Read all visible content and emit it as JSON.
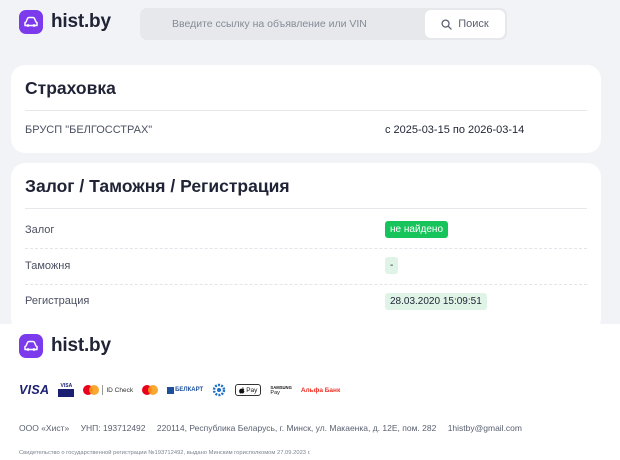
{
  "header": {
    "logo_text": "hist.by",
    "search": {
      "placeholder": "Введите ссылку на объявление или VIN",
      "button_label": "Поиск"
    }
  },
  "insurance": {
    "title": "Страховка",
    "company": "БРУСП \"БЕЛГОССТРАХ\"",
    "period": "с 2025-03-15 по 2026-03-14"
  },
  "registration_section": {
    "title": "Залог / Таможня / Регистрация",
    "rows": [
      {
        "label": "Залог",
        "value": "не найдено",
        "status_color": "#16c45b"
      },
      {
        "label": "Таможня",
        "value": "-"
      },
      {
        "label": "Регистрация",
        "value": "28.03.2020 15:09:51"
      }
    ]
  },
  "footer": {
    "logo_text": "hist.by",
    "payments": {
      "visa": "VISA",
      "visa_small_top": "VISA",
      "visa_small_bottom": "",
      "idcheck": "ID Check",
      "belkart": "БЕЛКАРТ",
      "belkart_sub": "",
      "belkart2": "",
      "apple_pay": "Pay",
      "samsung_top": "SAMSUNG",
      "samsung_bottom": "Pay",
      "alfa": "Альфа Банк"
    },
    "company": "ООО «Хист»",
    "unp": "УНП: 193712492",
    "address": "220114, Республика Беларусь, г. Минск, ул. Макаенка, д. 12Е, пом. 282",
    "email": "1histby@gmail.com",
    "certificate": "Свидетельство о государственной регистрации №193712492, выдано Минским горисполкомом 27.09.2023 г."
  },
  "colors": {
    "brand": "#7c3aed",
    "success": "#16c45b",
    "success_light": "#dff4e6",
    "visa_blue": "#1a1f71",
    "alfa_red": "#ef3124"
  }
}
